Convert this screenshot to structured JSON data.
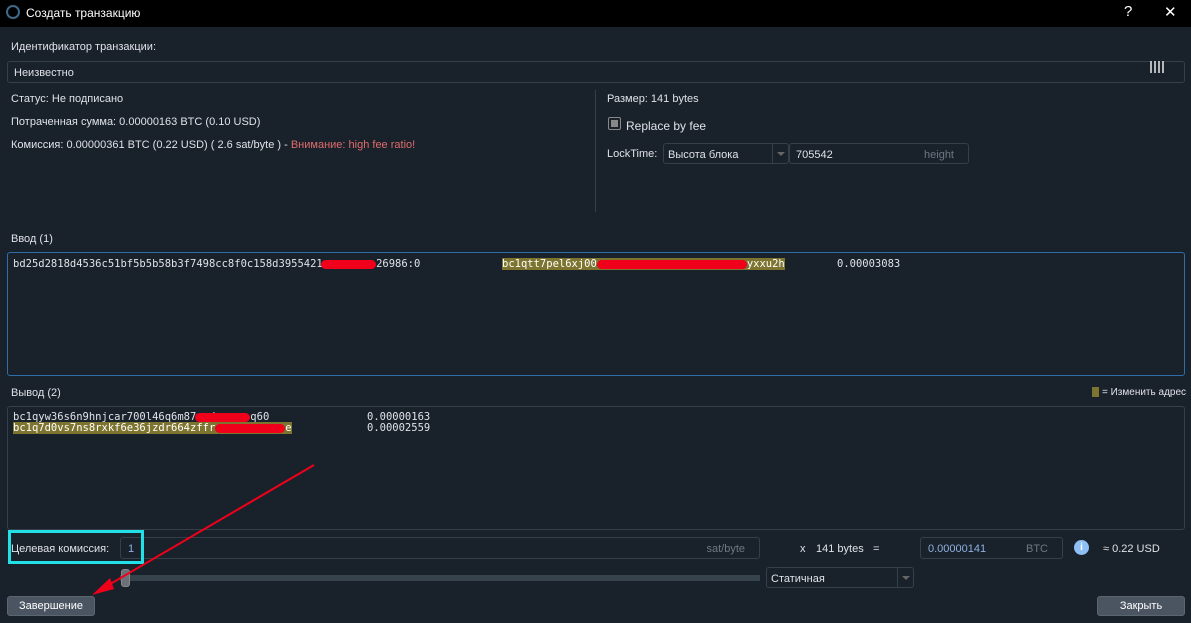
{
  "window": {
    "title": "Создать транзакцию",
    "help": "?",
    "close": "✕"
  },
  "txid": {
    "label": "Идентификатор транзакции:",
    "value": "Неизвестно"
  },
  "info": {
    "status": "Статус: Не подписано",
    "spent": "Потраченная сумма: 0.00000163 BTC (0.10 USD)",
    "fee": "Комиссия: 0.00000361 BTC (0.22 USD) ( 2.6 sat/byte ) -",
    "warning": "Внимание: high fee ratio!",
    "size": "Размер: 141 bytes",
    "rbf": "Replace by fee",
    "locktime_label": "LockTime:",
    "locktime_type": "Высота блока",
    "locktime_value": "705542",
    "locktime_unit": "height"
  },
  "inputs": {
    "label": "Ввод (1)",
    "rows": [
      {
        "prev_a": "bd25d2818d4536c51bf5b5b58b3f7498cc8f0c158d3955421e",
        "prev_b": "26986:0",
        "addr_a": "bc1qtt7pel6xj00",
        "addr_b": "yxxu2h",
        "amount": "0.00003083"
      }
    ]
  },
  "outputs": {
    "label": "Вывод (2)",
    "legend": "= Изменить адрес",
    "rows": [
      {
        "addr_a": "bc1qyw36s6n9hnjcar700l46q6m87wqd",
        "addr_b": "q60",
        "amount": "0.00000163",
        "change": false
      },
      {
        "addr_a": "bc1q7d0vs7ns8rxkf6e36jzdr664zffr",
        "addr_b": "e",
        "amount": "0.00002559",
        "change": true
      }
    ]
  },
  "fee": {
    "label": "Целевая комиссия:",
    "value": "1",
    "unit": "sat/byte",
    "times": "x",
    "bytes": "141 bytes",
    "eq": "=",
    "btc_value": "0.00000141",
    "btc_unit": "BTC",
    "usd": "≈ 0.22 USD",
    "mode": "Статичная",
    "slider_fraction": 0.0
  },
  "buttons": {
    "finalize": "Завершение",
    "close": "Закрыть"
  },
  "colors": {
    "change_highlight": "#7d7430",
    "warning": "#e06c6c",
    "annotation_red": "#f0001a",
    "annotation_cyan": "#22e0e8"
  }
}
